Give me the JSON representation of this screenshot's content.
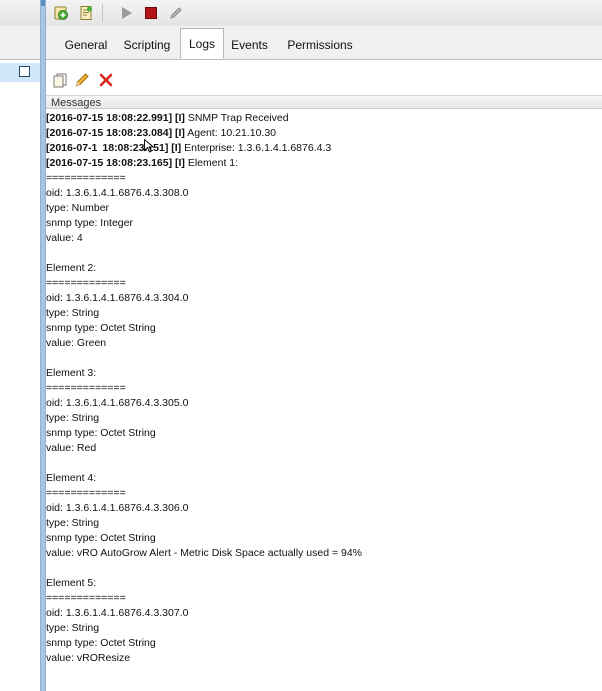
{
  "tabs": [
    {
      "label": "General"
    },
    {
      "label": "Scripting"
    },
    {
      "label": "Logs"
    },
    {
      "label": "Events"
    },
    {
      "label": "Permissions"
    }
  ],
  "messages": {
    "header": "Messages",
    "entries": [
      {
        "timestamp": "[2016-07-15 18:08:22.991] [I]",
        "text": " SNMP Trap Received"
      },
      {
        "timestamp": "[2016-07-15 18:08:23.084] [I]",
        "text": " Agent: 10.21.10.30"
      },
      {
        "timestamp": "[2016-07-1  18:08:23.151] [I]",
        "text": " Enterprise: 1.3.6.1.4.1.6876.4.3"
      },
      {
        "timestamp": "[2016-07-15 18:08:23.165] [I]",
        "text": " Element 1:"
      },
      {
        "timestamp": "",
        "text": "============="
      },
      {
        "timestamp": "",
        "text": "oid: 1.3.6.1.4.1.6876.4.3.308.0"
      },
      {
        "timestamp": "",
        "text": "type: Number"
      },
      {
        "timestamp": "",
        "text": "snmp type: Integer"
      },
      {
        "timestamp": "",
        "text": "value: 4"
      },
      {
        "timestamp": "",
        "text": ""
      },
      {
        "timestamp": "",
        "text": "Element 2:"
      },
      {
        "timestamp": "",
        "text": "============="
      },
      {
        "timestamp": "",
        "text": "oid: 1.3.6.1.4.1.6876.4.3.304.0"
      },
      {
        "timestamp": "",
        "text": "type: String"
      },
      {
        "timestamp": "",
        "text": "snmp type: Octet String"
      },
      {
        "timestamp": "",
        "text": "value: Green"
      },
      {
        "timestamp": "",
        "text": ""
      },
      {
        "timestamp": "",
        "text": "Element 3:"
      },
      {
        "timestamp": "",
        "text": "============="
      },
      {
        "timestamp": "",
        "text": "oid: 1.3.6.1.4.1.6876.4.3.305.0"
      },
      {
        "timestamp": "",
        "text": "type: String"
      },
      {
        "timestamp": "",
        "text": "snmp type: Octet String"
      },
      {
        "timestamp": "",
        "text": "value: Red"
      },
      {
        "timestamp": "",
        "text": ""
      },
      {
        "timestamp": "",
        "text": "Element 4:"
      },
      {
        "timestamp": "",
        "text": "============="
      },
      {
        "timestamp": "",
        "text": "oid: 1.3.6.1.4.1.6876.4.3.306.0"
      },
      {
        "timestamp": "",
        "text": "type: String"
      },
      {
        "timestamp": "",
        "text": "snmp type: Octet String"
      },
      {
        "timestamp": "",
        "text": "value: vRO AutoGrow Alert - Metric Disk Space actually used = 94%"
      },
      {
        "timestamp": "",
        "text": ""
      },
      {
        "timestamp": "",
        "text": "Element 5:"
      },
      {
        "timestamp": "",
        "text": "============="
      },
      {
        "timestamp": "",
        "text": "oid: 1.3.6.1.4.1.6876.4.3.307.0"
      },
      {
        "timestamp": "",
        "text": "type: String"
      },
      {
        "timestamp": "",
        "text": "snmp type: Octet String"
      },
      {
        "timestamp": "",
        "text": "value: vROResize"
      }
    ]
  },
  "icons": {
    "toolbar": [
      "add-workflow-icon",
      "import-icon",
      "run-icon",
      "stop-icon",
      "edit-icon"
    ],
    "logs_toolbar": [
      "copy-icon",
      "edit-icon",
      "clear-icon"
    ]
  },
  "colors": {
    "selection": "#cfe6fb",
    "splitter": "#a7c4e0",
    "stop": "#b3151b",
    "clear": "#d8261e"
  }
}
